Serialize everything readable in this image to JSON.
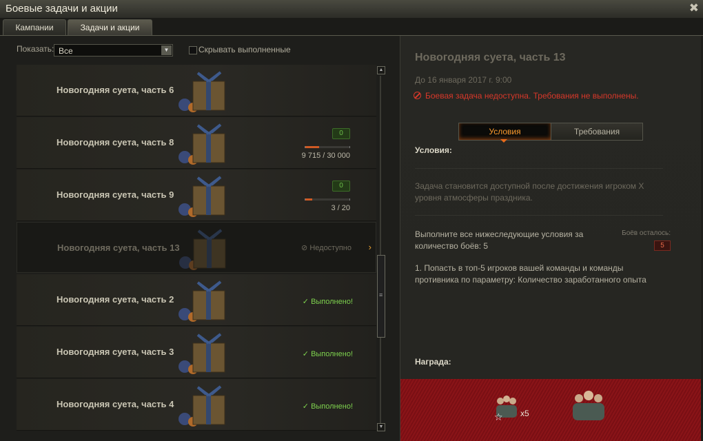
{
  "window": {
    "title": "Боевые задачи и акции",
    "close_glyph": "✖"
  },
  "tabs": [
    {
      "label": "Кампании",
      "active": false
    },
    {
      "label": "Задачи и акции",
      "active": true
    }
  ],
  "filter": {
    "label": "Показать:",
    "value": "Все",
    "hide_completed_label": "Скрывать выполненные",
    "hide_completed_checked": false
  },
  "quests": [
    {
      "name": "Новогодняя суета, часть 6"
    },
    {
      "name": "Новогодняя суета, часть 8",
      "badge": "0",
      "progress": "9 715 / 30 000",
      "progress_fraction": 0.32
    },
    {
      "name": "Новогодняя суета, часть 9",
      "badge": "0",
      "progress": "3 / 20",
      "progress_fraction": 0.15
    },
    {
      "name": "Новогодняя суета, часть 13",
      "status": "Недоступно",
      "selected": true
    },
    {
      "name": "Новогодняя суета, часть 2",
      "status": "Выполнено!"
    },
    {
      "name": "Новогодняя суета, часть 3",
      "status": "Выполнено!"
    },
    {
      "name": "Новогодняя суета, часть 4",
      "status": "Выполнено!"
    }
  ],
  "detail": {
    "title": "Новогодняя суета, часть 13",
    "deadline": "До 16 января 2017 г. 9:00",
    "warning": "Боевая задача недоступна. Требования не выполнены.",
    "tabs": [
      {
        "label": "Условия",
        "active": true
      },
      {
        "label": "Требования",
        "active": false
      }
    ],
    "conditions_header": "Условия:",
    "availability": "Задача становится доступной после достижения игроком X уровня атмосферы праздника.",
    "task_text": "Выполните все нижеследующие условия за количество боёв: 5",
    "battles_left_label": "Боёв осталось:",
    "battles_left": "5",
    "condition_1": "1. Попасть в топ-5 игроков вашей команды и команды противника по параметру: Количество заработанного опыта",
    "reward_header": "Награда:",
    "reward_multiplier": "x5"
  },
  "colors": {
    "ok": "#7ed24e",
    "warning": "#d8382a",
    "accent": "#ff9c2e",
    "progress": "#d05a24"
  }
}
